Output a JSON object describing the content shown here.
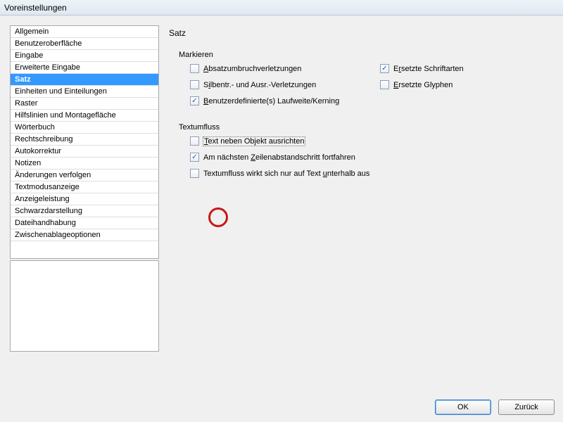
{
  "window": {
    "title": "Voreinstellungen"
  },
  "sidebar": {
    "items": [
      "Allgemein",
      "Benutzeroberfläche",
      "Eingabe",
      "Erweiterte Eingabe",
      "Satz",
      "Einheiten und Einteilungen",
      "Raster",
      "Hilfslinien und Montagefläche",
      "Wörterbuch",
      "Rechtschreibung",
      "Autokorrektur",
      "Notizen",
      "Änderungen verfolgen",
      "Textmodusanzeige",
      "Anzeigeleistung",
      "Schwarzdarstellung",
      "Dateihandhabung",
      "Zwischenablageoptionen"
    ],
    "selected_index": 4
  },
  "panel": {
    "title": "Satz",
    "groups": {
      "markieren": {
        "label": "Markieren",
        "items": [
          {
            "key": "absatzumbruch",
            "label_html": "<u>A</u>bsatzumbruchverletzungen",
            "checked": false
          },
          {
            "key": "schriftarten",
            "label_html": "E<u>r</u>setzte Schriftarten",
            "checked": true
          },
          {
            "key": "silbentr",
            "label_html": "S<u>i</u>lbentr.- und Ausr.-Verletzungen",
            "checked": false
          },
          {
            "key": "glyphen",
            "label_html": "<u>E</u>rsetzte Glyphen",
            "checked": false
          },
          {
            "key": "laufweite",
            "label_html": "<u>B</u>enutzerdefinierte(s) Laufweite/Kerning",
            "checked": true
          }
        ]
      },
      "textumfluss": {
        "label": "Textumfluss",
        "items": [
          {
            "key": "neben-objekt",
            "label_html": "<u>T</u>ext neben Objekt ausrichten",
            "checked": false,
            "focused": true
          },
          {
            "key": "zeilenabstand",
            "label_html": "Am nächsten <u>Z</u>eilenabstandschritt fortfahren",
            "checked": true,
            "highlighted": true
          },
          {
            "key": "unterhalb",
            "label_html": "Textumfluss wirkt sich nur auf Text <u>u</u>nterhalb aus",
            "checked": false
          }
        ]
      }
    }
  },
  "buttons": {
    "ok": "OK",
    "back": "Zurück"
  }
}
